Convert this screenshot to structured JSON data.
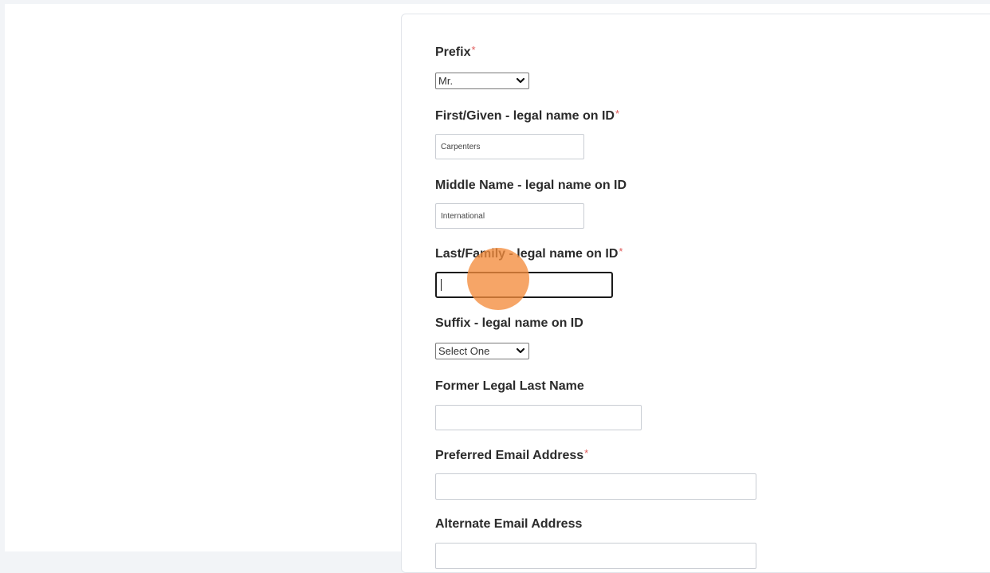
{
  "form": {
    "required_mark": "*",
    "prefix": {
      "label": "Prefix",
      "required": true,
      "value": "Mr."
    },
    "first_name": {
      "label": "First/Given - legal name on ID",
      "required": true,
      "value": "Carpenters"
    },
    "middle_name": {
      "label": "Middle Name - legal name on ID",
      "required": false,
      "value": "International"
    },
    "last_name": {
      "label": "Last/Family - legal name on ID",
      "required": true,
      "value": ""
    },
    "suffix": {
      "label": "Suffix - legal name on ID",
      "required": false,
      "value": "Select One"
    },
    "former_last_name": {
      "label": "Former Legal Last Name",
      "required": false,
      "value": ""
    },
    "preferred_email": {
      "label": "Preferred Email Address",
      "required": true,
      "value": ""
    },
    "alternate_email": {
      "label": "Alternate Email Address",
      "required": false,
      "value": ""
    }
  },
  "colors": {
    "required_mark": "#e05a5a",
    "click_indicator": "#f48c3c",
    "active_border": "#1a1a1a"
  },
  "icons": {
    "select_arrow": "chevron-down-icon",
    "click_highlight": "click-indicator"
  }
}
